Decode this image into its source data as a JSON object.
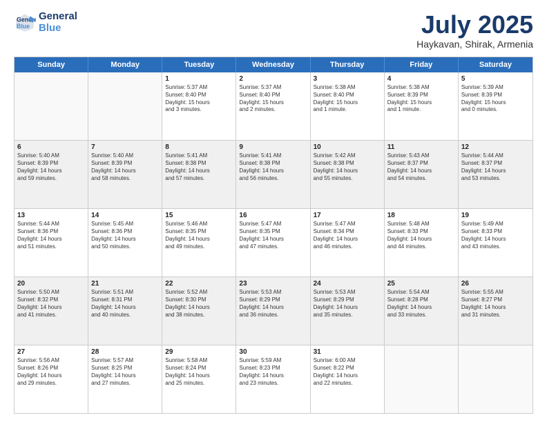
{
  "header": {
    "logo_line1": "General",
    "logo_line2": "Blue",
    "month": "July 2025",
    "location": "Haykavan, Shirak, Armenia"
  },
  "weekdays": [
    "Sunday",
    "Monday",
    "Tuesday",
    "Wednesday",
    "Thursday",
    "Friday",
    "Saturday"
  ],
  "rows": [
    [
      {
        "day": "",
        "text": ""
      },
      {
        "day": "",
        "text": ""
      },
      {
        "day": "1",
        "text": "Sunrise: 5:37 AM\nSunset: 8:40 PM\nDaylight: 15 hours\nand 3 minutes."
      },
      {
        "day": "2",
        "text": "Sunrise: 5:37 AM\nSunset: 8:40 PM\nDaylight: 15 hours\nand 2 minutes."
      },
      {
        "day": "3",
        "text": "Sunrise: 5:38 AM\nSunset: 8:40 PM\nDaylight: 15 hours\nand 1 minute."
      },
      {
        "day": "4",
        "text": "Sunrise: 5:38 AM\nSunset: 8:39 PM\nDaylight: 15 hours\nand 1 minute."
      },
      {
        "day": "5",
        "text": "Sunrise: 5:39 AM\nSunset: 8:39 PM\nDaylight: 15 hours\nand 0 minutes."
      }
    ],
    [
      {
        "day": "6",
        "text": "Sunrise: 5:40 AM\nSunset: 8:39 PM\nDaylight: 14 hours\nand 59 minutes."
      },
      {
        "day": "7",
        "text": "Sunrise: 5:40 AM\nSunset: 8:39 PM\nDaylight: 14 hours\nand 58 minutes."
      },
      {
        "day": "8",
        "text": "Sunrise: 5:41 AM\nSunset: 8:38 PM\nDaylight: 14 hours\nand 57 minutes."
      },
      {
        "day": "9",
        "text": "Sunrise: 5:41 AM\nSunset: 8:38 PM\nDaylight: 14 hours\nand 56 minutes."
      },
      {
        "day": "10",
        "text": "Sunrise: 5:42 AM\nSunset: 8:38 PM\nDaylight: 14 hours\nand 55 minutes."
      },
      {
        "day": "11",
        "text": "Sunrise: 5:43 AM\nSunset: 8:37 PM\nDaylight: 14 hours\nand 54 minutes."
      },
      {
        "day": "12",
        "text": "Sunrise: 5:44 AM\nSunset: 8:37 PM\nDaylight: 14 hours\nand 53 minutes."
      }
    ],
    [
      {
        "day": "13",
        "text": "Sunrise: 5:44 AM\nSunset: 8:36 PM\nDaylight: 14 hours\nand 51 minutes."
      },
      {
        "day": "14",
        "text": "Sunrise: 5:45 AM\nSunset: 8:36 PM\nDaylight: 14 hours\nand 50 minutes."
      },
      {
        "day": "15",
        "text": "Sunrise: 5:46 AM\nSunset: 8:35 PM\nDaylight: 14 hours\nand 49 minutes."
      },
      {
        "day": "16",
        "text": "Sunrise: 5:47 AM\nSunset: 8:35 PM\nDaylight: 14 hours\nand 47 minutes."
      },
      {
        "day": "17",
        "text": "Sunrise: 5:47 AM\nSunset: 8:34 PM\nDaylight: 14 hours\nand 46 minutes."
      },
      {
        "day": "18",
        "text": "Sunrise: 5:48 AM\nSunset: 8:33 PM\nDaylight: 14 hours\nand 44 minutes."
      },
      {
        "day": "19",
        "text": "Sunrise: 5:49 AM\nSunset: 8:33 PM\nDaylight: 14 hours\nand 43 minutes."
      }
    ],
    [
      {
        "day": "20",
        "text": "Sunrise: 5:50 AM\nSunset: 8:32 PM\nDaylight: 14 hours\nand 41 minutes."
      },
      {
        "day": "21",
        "text": "Sunrise: 5:51 AM\nSunset: 8:31 PM\nDaylight: 14 hours\nand 40 minutes."
      },
      {
        "day": "22",
        "text": "Sunrise: 5:52 AM\nSunset: 8:30 PM\nDaylight: 14 hours\nand 38 minutes."
      },
      {
        "day": "23",
        "text": "Sunrise: 5:53 AM\nSunset: 8:29 PM\nDaylight: 14 hours\nand 36 minutes."
      },
      {
        "day": "24",
        "text": "Sunrise: 5:53 AM\nSunset: 8:29 PM\nDaylight: 14 hours\nand 35 minutes."
      },
      {
        "day": "25",
        "text": "Sunrise: 5:54 AM\nSunset: 8:28 PM\nDaylight: 14 hours\nand 33 minutes."
      },
      {
        "day": "26",
        "text": "Sunrise: 5:55 AM\nSunset: 8:27 PM\nDaylight: 14 hours\nand 31 minutes."
      }
    ],
    [
      {
        "day": "27",
        "text": "Sunrise: 5:56 AM\nSunset: 8:26 PM\nDaylight: 14 hours\nand 29 minutes."
      },
      {
        "day": "28",
        "text": "Sunrise: 5:57 AM\nSunset: 8:25 PM\nDaylight: 14 hours\nand 27 minutes."
      },
      {
        "day": "29",
        "text": "Sunrise: 5:58 AM\nSunset: 8:24 PM\nDaylight: 14 hours\nand 25 minutes."
      },
      {
        "day": "30",
        "text": "Sunrise: 5:59 AM\nSunset: 8:23 PM\nDaylight: 14 hours\nand 23 minutes."
      },
      {
        "day": "31",
        "text": "Sunrise: 6:00 AM\nSunset: 8:22 PM\nDaylight: 14 hours\nand 22 minutes."
      },
      {
        "day": "",
        "text": ""
      },
      {
        "day": "",
        "text": ""
      }
    ]
  ]
}
